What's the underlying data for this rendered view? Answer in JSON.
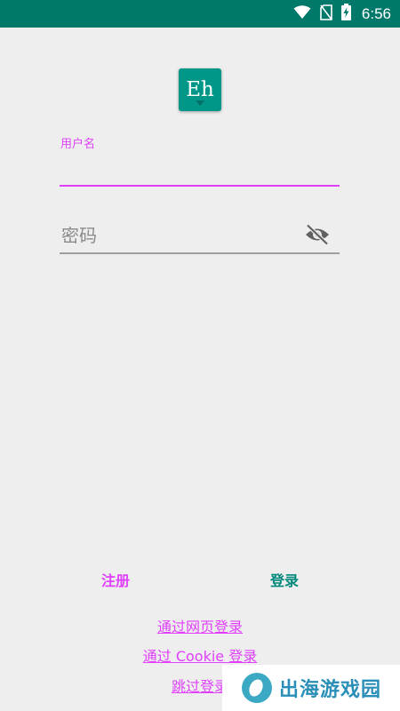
{
  "status_bar": {
    "time": "6:56",
    "icons": [
      "wifi-icon",
      "no-sim-icon",
      "battery-charging-icon"
    ],
    "background": "#00796b"
  },
  "logo": {
    "text": "Eh",
    "color": "#009688"
  },
  "form": {
    "username": {
      "label": "用户名",
      "value": "",
      "accent": "#e040fb"
    },
    "password": {
      "placeholder": "密码",
      "value": "",
      "visibility_icon": "eye-off-icon"
    }
  },
  "actions": {
    "register_label": "注册",
    "login_label": "登录"
  },
  "links": {
    "web_login": "通过网页登录",
    "cookie_login": "通过 Cookie 登录",
    "skip_login": "跳过登录"
  },
  "watermark": {
    "text": "出海游戏园"
  }
}
